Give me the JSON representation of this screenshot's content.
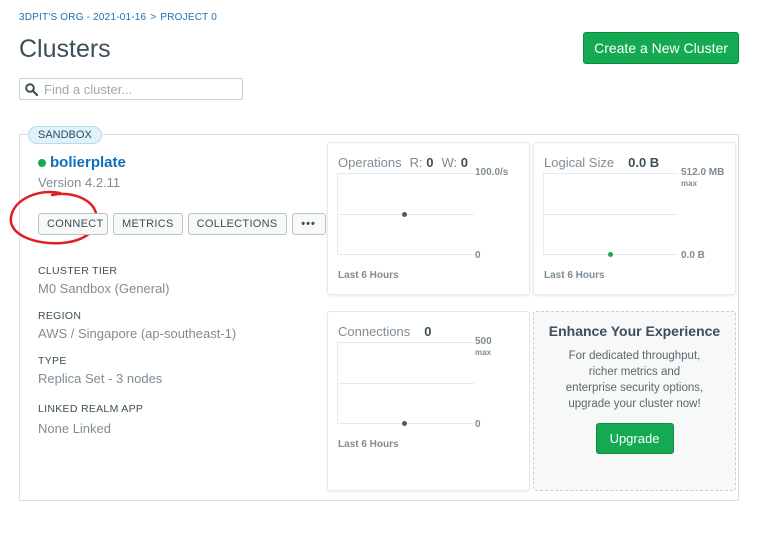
{
  "breadcrumb": {
    "org": "3DPIT'S ORG - 2021-01-16",
    "separator": ">",
    "project": "PROJECT 0"
  },
  "header": {
    "title": "Clusters",
    "create_label": "Create a New Cluster"
  },
  "search": {
    "placeholder": "Find a cluster..."
  },
  "cluster": {
    "badge": "SANDBOX",
    "name": "bolierplate",
    "status_color": "#13aa52",
    "version": "Version 4.2.11",
    "buttons": {
      "connect": "CONNECT",
      "metrics": "METRICS",
      "collections": "COLLECTIONS",
      "more": "•••"
    },
    "info": [
      {
        "label": "CLUSTER TIER",
        "value": "M0 Sandbox (General)"
      },
      {
        "label": "REGION",
        "value": "AWS / Singapore (ap-southeast-1)"
      },
      {
        "label": "TYPE",
        "value": "Replica Set - 3 nodes"
      },
      {
        "label": "LINKED REALM APP",
        "value": "None Linked"
      }
    ]
  },
  "metrics": {
    "operations": {
      "title": "Operations",
      "r_label": "R:",
      "r_value": "0",
      "w_label": "W:",
      "w_value": "0",
      "max": "100.0/s",
      "min": "0",
      "footer": "Last 6 Hours"
    },
    "logical_size": {
      "title": "Logical Size",
      "value": "0.0 B",
      "max": "512.0 MB",
      "max_sub": "max",
      "min": "0.0 B",
      "footer": "Last 6 Hours"
    },
    "connections": {
      "title": "Connections",
      "value": "0",
      "max": "500",
      "max_sub": "max",
      "min": "0",
      "footer": "Last 6 Hours"
    }
  },
  "enhance": {
    "title": "Enhance Your Experience",
    "body": "For dedicated throughput, richer metrics and enterprise security options, upgrade your cluster now!",
    "button": "Upgrade"
  },
  "colors": {
    "brand_green": "#13aa52",
    "link_blue": "#0d70b8",
    "annotation_red": "#e02020"
  }
}
